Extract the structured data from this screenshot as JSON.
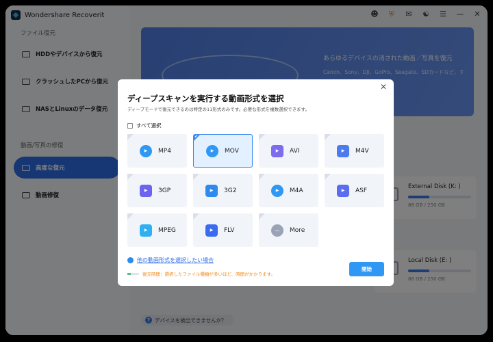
{
  "app": {
    "title": "Wondershare Recoverit"
  },
  "sidebar": {
    "section_file": "ファイル復元",
    "items": [
      {
        "label": "HDDやデバイスから復元"
      },
      {
        "label": "クラッシュしたPCから復元"
      },
      {
        "label": "NASとLinuxのデータ復元"
      }
    ],
    "section_repair": "動画/写真の修復",
    "advanced": "高度な復元",
    "video_repair": "動画修復"
  },
  "topbar": {
    "icons": [
      "user-icon",
      "cart-icon",
      "mail-icon",
      "headset-icon",
      "menu-icon",
      "minimize-icon",
      "close-icon"
    ]
  },
  "banner": {
    "title": "あらゆるデバイスの消された動画／写真を復元",
    "subtitle": "Canon、Sony、DJI、GoPro、Seagate、SDカードなど、す"
  },
  "drives": [
    {
      "name": "External Disk (K: )",
      "size": "86 GB / 250 GB",
      "used_fraction": 0.34
    },
    {
      "name": "Local Disk (E: )",
      "size": "86 GB / 250 GB",
      "used_fraction": 0.34
    }
  ],
  "help_link": "デバイスを検出できませんか？",
  "dialog": {
    "title": "ディープスキャンを実行する動画形式を選択",
    "subtitle": "ディープモードで復元できるのは特定の11形式のみです。必要な形式を複数選択できます。",
    "select_all": "すべて選択",
    "formats": [
      {
        "label": "MP4",
        "color": "#2f98f5",
        "selected": false
      },
      {
        "label": "MOV",
        "color": "#2f98f5",
        "selected": true
      },
      {
        "label": "AVI",
        "color": "#7b6cf0",
        "selected": false
      },
      {
        "label": "M4V",
        "color": "#4a7cf0",
        "selected": false
      },
      {
        "label": "3GP",
        "color": "#6c63f0",
        "selected": false
      },
      {
        "label": "3G2",
        "color": "#2f8af0",
        "selected": false
      },
      {
        "label": "M4A",
        "color": "#2f98f5",
        "selected": false
      },
      {
        "label": "ASF",
        "color": "#5a6cf0",
        "selected": false
      },
      {
        "label": "MPEG",
        "color": "#2fb0f5",
        "selected": false
      },
      {
        "label": "FLV",
        "color": "#3a6cf0",
        "selected": false
      },
      {
        "label": "More",
        "color": "#9aa3b5",
        "selected": false
      }
    ],
    "other_link": "他の動画形式を選択したい場合",
    "time_note": "復元時間：選択したファイル種類が多いほど、時間がかかります。",
    "start": "開始"
  }
}
